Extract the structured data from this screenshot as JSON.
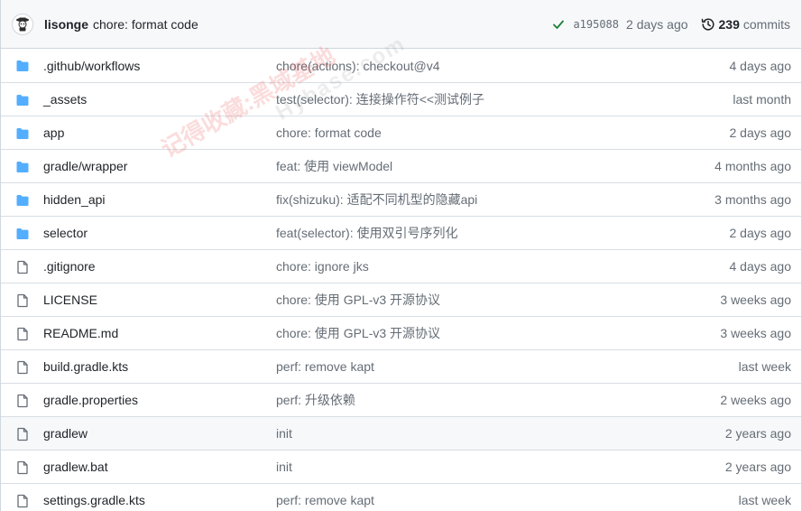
{
  "commit": {
    "author": "lisonge",
    "message": "chore: format code",
    "status_icon": "check-icon",
    "sha": "a195088",
    "time": "2 days ago",
    "history_icon": "history-icon",
    "commit_count": "239",
    "commit_label": "commits"
  },
  "colors": {
    "folder": "#54aeff",
    "file": "#656d76",
    "check": "#1a7f37"
  },
  "files": [
    {
      "type": "folder",
      "name": ".github/workflows",
      "message": "chore(actions): checkout@v4",
      "age": "4 days ago"
    },
    {
      "type": "folder",
      "name": "_assets",
      "message": "test(selector): 连接操作符<<测试例子",
      "age": "last month"
    },
    {
      "type": "folder",
      "name": "app",
      "message": "chore: format code",
      "age": "2 days ago"
    },
    {
      "type": "folder",
      "name": "gradle/wrapper",
      "message": "feat: 使用 viewModel",
      "age": "4 months ago"
    },
    {
      "type": "folder",
      "name": "hidden_api",
      "message": "fix(shizuku): 适配不同机型的隐藏api",
      "age": "3 months ago"
    },
    {
      "type": "folder",
      "name": "selector",
      "message": "feat(selector): 使用双引号序列化",
      "age": "2 days ago"
    },
    {
      "type": "file",
      "name": ".gitignore",
      "message": "chore: ignore jks",
      "age": "4 days ago"
    },
    {
      "type": "file",
      "name": "LICENSE",
      "message": "chore: 使用 GPL-v3 开源协议",
      "age": "3 weeks ago"
    },
    {
      "type": "file",
      "name": "README.md",
      "message": "chore: 使用 GPL-v3 开源协议",
      "age": "3 weeks ago"
    },
    {
      "type": "file",
      "name": "build.gradle.kts",
      "message": "perf: remove kapt",
      "age": "last week"
    },
    {
      "type": "file",
      "name": "gradle.properties",
      "message": "perf: 升级依赖",
      "age": "2 weeks ago"
    },
    {
      "type": "file",
      "name": "gradlew",
      "message": "init",
      "age": "2 years ago"
    },
    {
      "type": "file",
      "name": "gradlew.bat",
      "message": "init",
      "age": "2 years ago"
    },
    {
      "type": "file",
      "name": "settings.gradle.kts",
      "message": "perf: remove kapt",
      "age": "last week"
    }
  ],
  "watermark": {
    "line1": "记得收藏:黑域基地",
    "line2": "Hybase.com"
  }
}
